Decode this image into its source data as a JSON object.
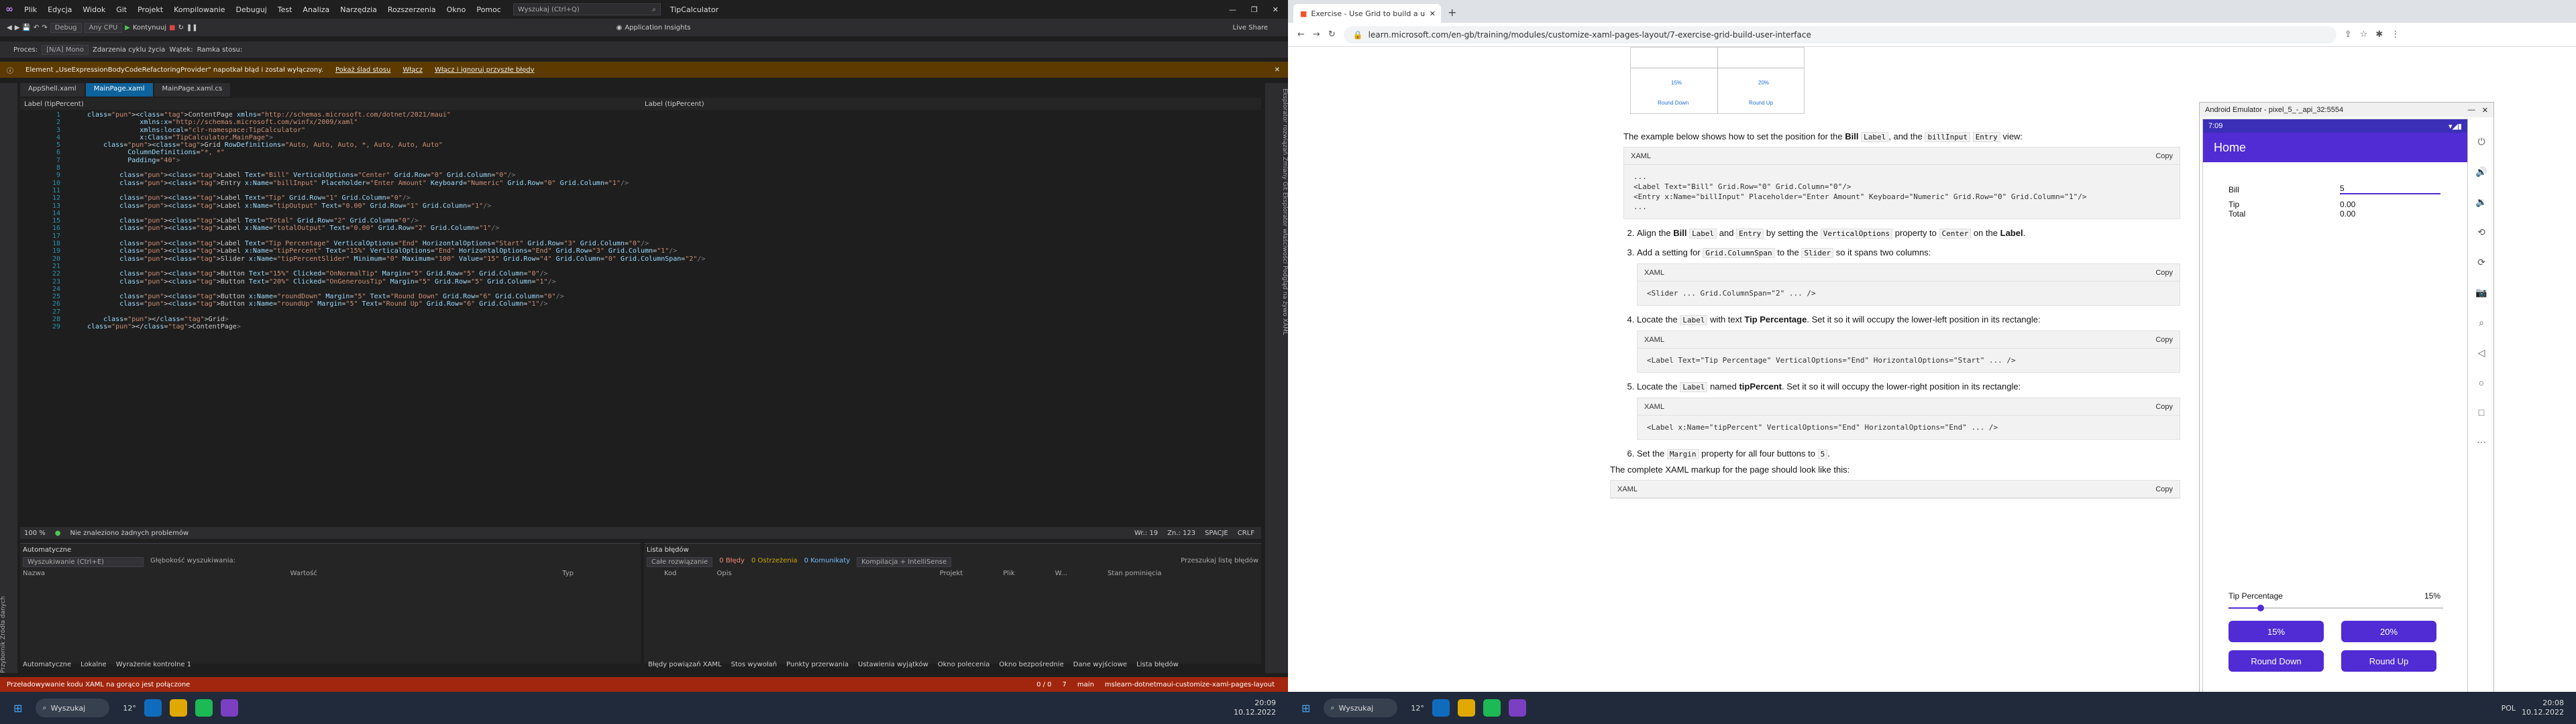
{
  "vs": {
    "menu": [
      "Plik",
      "Edycja",
      "Widok",
      "Git",
      "Projekt",
      "Kompilowanie",
      "Debuguj",
      "Test",
      "Analiza",
      "Narzędzia",
      "Rozszerzenia",
      "Okno",
      "Pomoc"
    ],
    "search_placeholder": "Wyszukaj (Ctrl+Q)",
    "app_title": "TipCalculator",
    "toolbar_items": [
      "Debug",
      "Any CPU",
      "Kontynuuj",
      "Application Insights",
      "Live Share"
    ],
    "process_label": "Proces:",
    "process_value": "[N/A] Mono",
    "process_extra": [
      "Zdarzenia cyklu życia",
      "Wątek:",
      "Ramka stosu:"
    ],
    "infobar": {
      "message": "Element „UseExpressionBodyCodeRefactoringProvider\" napotkał błąd i został wyłączony.",
      "actions": [
        "Pokaż ślad stosu",
        "Włącz",
        "Włącz i ignoruj przyszłe błędy"
      ]
    },
    "tabs": [
      "AppShell.xaml",
      "MainPage.xaml",
      "MainPage.xaml.cs"
    ],
    "crumbs": [
      "Label (tipPercent)",
      "Label (tipPercent)"
    ],
    "code_lines": [
      "<ContentPage xmlns=\"http://schemas.microsoft.com/dotnet/2021/maui\"",
      "             xmlns:x=\"http://schemas.microsoft.com/winfx/2009/xaml\"",
      "             xmlns:local=\"clr-namespace:TipCalculator\"",
      "             x:Class=\"TipCalculator.MainPage\">",
      "    <Grid RowDefinitions=\"Auto, Auto, Auto, *, Auto, Auto, Auto\"",
      "          ColumnDefinitions=\"*, *\"",
      "          Padding=\"40\">",
      "",
      "        <Label Text=\"Bill\" VerticalOptions=\"Center\" Grid.Row=\"0\" Grid.Column=\"0\"/>",
      "        <Entry x:Name=\"billInput\" Placeholder=\"Enter Amount\" Keyboard=\"Numeric\" Grid.Row=\"0\" Grid.Column=\"1\"/>",
      "",
      "        <Label Text=\"Tip\" Grid.Row=\"1\" Grid.Column=\"0\"/>",
      "        <Label x:Name=\"tipOutput\" Text=\"0.00\" Grid.Row=\"1\" Grid.Column=\"1\"/>",
      "",
      "        <Label Text=\"Total\" Grid.Row=\"2\" Grid.Column=\"0\"/>",
      "        <Label x:Name=\"totalOutput\" Text=\"0.00\" Grid.Row=\"2\" Grid.Column=\"1\"/>",
      "",
      "        <Label Text=\"Tip Percentage\" VerticalOptions=\"End\" HorizontalOptions=\"Start\" Grid.Row=\"3\" Grid.Column=\"0\"/>",
      "        <Label x:Name=\"tipPercent\" Text=\"15%\" VerticalOptions=\"End\" HorizontalOptions=\"End\" Grid.Row=\"3\" Grid.Column=\"1\"/>",
      "        <Slider x:Name=\"tipPercentSlider\" Minimum=\"0\" Maximum=\"100\" Value=\"15\" Grid.Row=\"4\" Grid.Column=\"0\" Grid.ColumnSpan=\"2\"/>",
      "",
      "        <Button Text=\"15%\" Clicked=\"OnNormalTip\" Margin=\"5\" Grid.Row=\"5\" Grid.Column=\"0\"/>",
      "        <Button Text=\"20%\" Clicked=\"OnGenerousTip\" Margin=\"5\" Grid.Row=\"5\" Grid.Column=\"1\"/>",
      "",
      "        <Button x:Name=\"roundDown\" Margin=\"5\" Text=\"Round Down\" Grid.Row=\"6\" Grid.Column=\"0\"/>",
      "        <Button x:Name=\"roundUp\" Margin=\"5\" Text=\"Round Up\" Grid.Row=\"6\" Grid.Column=\"1\"/>",
      "",
      "    </Grid>",
      "</ContentPage>"
    ],
    "editor_status": {
      "zoom": "100 %",
      "issues": "Nie znaleziono żadnych problemów",
      "line": "Wr.: 19",
      "char": "Zn.: 123",
      "space": "SPACJE",
      "eol": "CRLF"
    },
    "auto_panel": {
      "title": "Automatyczne",
      "search": "Wyszukiwanie (Ctrl+E)",
      "depth": "Głębokość wyszukiwania:",
      "cols": [
        "Nazwa",
        "Wartość",
        "Typ"
      ],
      "tabs": [
        "Automatyczne",
        "Lokalne",
        "Wyrażenie kontrolne 1"
      ]
    },
    "errors_panel": {
      "title": "Lista błędów",
      "scope": "Całe rozwiązanie",
      "errors": "0 Błędy",
      "warnings": "0 Ostrzeżenia",
      "messages": "0 Komunikaty",
      "build": "Kompilacja + IntelliSense",
      "search": "Przeszukaj listę błędów",
      "cols": [
        "Kod",
        "Opis",
        "Projekt",
        "Plik",
        "W...",
        "Stan pominięcia"
      ],
      "tabs": [
        "Błędy powiązań XAML",
        "Stos wywołań",
        "Punkty przerwania",
        "Ustawienia wyjątków",
        "Okno polecenia",
        "Okno bezpośrednie",
        "Dane wyjściowe",
        "Lista błędów"
      ]
    },
    "statusbar": {
      "left": "Przeładowywanie kodu XAML na gorąco jest połączone",
      "counts": "0 / 0",
      "pencil": "7",
      "branch": "main",
      "repo": "mslearn-dotnetmaui-customize-xaml-pages-layout"
    },
    "right_strip": "Eksplorator rozwiązań   Zmiany Git   Eksplorator właściwości   Podgląd na żywo XAML",
    "left_strip": "Przybornik   Źródła danych"
  },
  "browser": {
    "tab_title": "Exercise - Use Grid to build a u",
    "url": "learn.microsoft.com/en-gb/training/modules/customize-xaml-pages-layout/7-exercise-grid-build-user-interface",
    "intro": {
      "before": "The example below shows how to set the position for the ",
      "bill": "Bill",
      "label": "Label",
      "and": ", and the ",
      "billInput": "billInput",
      "entry": "Entry",
      "after": " view:"
    },
    "xaml_label": "XAML",
    "copy_label": "Copy",
    "block1": [
      "...",
      "<Label Text=\"Bill\" Grid.Row=\"0\" Grid.Column=\"0\"/>",
      "<Entry x:Name=\"billInput\" Placeholder=\"Enter Amount\" Keyboard=\"Numeric\" Grid.Row=\"0\" Grid.Column=\"1\"/>",
      "..."
    ],
    "step2": {
      "a": "Align the ",
      "b": "Bill",
      "c": "Label",
      "d": " and ",
      "e": "Entry",
      "f": " by setting the ",
      "g": "VerticalOptions",
      "h": " property to ",
      "i": "Center",
      "j": " on the ",
      "k": "Label",
      "l": "."
    },
    "step3": {
      "a": "Add a setting for ",
      "b": "Grid.ColumnSpan",
      "c": " to the ",
      "d": "Slider",
      "e": " so it spans two columns:"
    },
    "block2": "<Slider ... Grid.ColumnSpan=\"2\" ... />",
    "step4": {
      "a": "Locate the ",
      "b": "Label",
      "c": " with text ",
      "d": "Tip Percentage",
      "e": ". Set it so it will occupy the lower-left position in its rectangle:"
    },
    "block3": "<Label Text=\"Tip Percentage\" VerticalOptions=\"End\" HorizontalOptions=\"Start\" ... />",
    "step5": {
      "a": "Locate the ",
      "b": "Label",
      "c": " named ",
      "d": "tipPercent",
      "e": ". Set it so it will occupy the lower-right position in its rectangle:"
    },
    "block4": "<Label x:Name=\"tipPercent\" VerticalOptions=\"End\" HorizontalOptions=\"End\" ... />",
    "step6": {
      "a": "Set the ",
      "b": "Margin",
      "c": " property for all four buttons to ",
      "d": "5",
      "e": "."
    },
    "complete": "The complete XAML markup for the page should look like this:",
    "fig_labels": [
      "15%",
      "20%",
      "Round Down",
      "Round Up"
    ]
  },
  "emulator": {
    "title": "Android Emulator - pixel_5_-_api_32:5554",
    "time": "7:09",
    "app_title": "Home",
    "bill_label": "Bill",
    "bill_value": "5",
    "tip_label": "Tip",
    "tip_value": "0.00",
    "total_label": "Total",
    "total_value": "0.00",
    "tip_pct_label": "Tip Percentage",
    "tip_pct_value": "15%",
    "slider_value": 15,
    "btn_15": "15%",
    "btn_20": "20%",
    "btn_down": "Round Down",
    "btn_up": "Round Up"
  },
  "taskbar": {
    "search": "Wyszukaj",
    "weather": "12°",
    "lang": "POL",
    "time": "20:09",
    "date": "10.12.2022",
    "time2": "20:08",
    "date2": "10.12.2022"
  }
}
